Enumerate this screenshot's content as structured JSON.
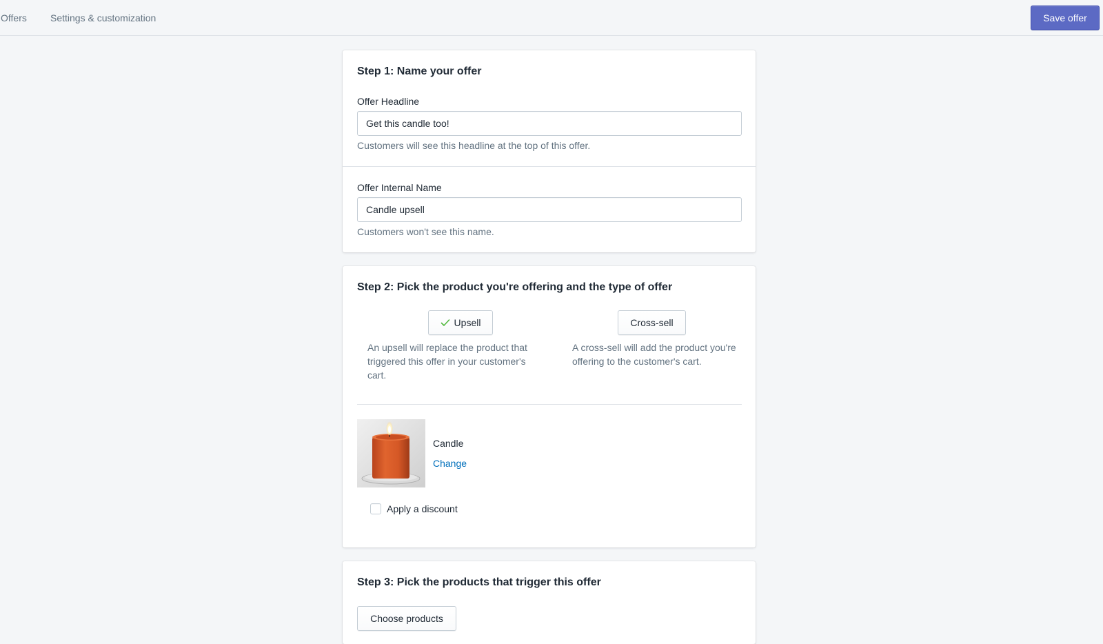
{
  "nav": {
    "offers_label": "Offers",
    "settings_label": "Settings & customization"
  },
  "toolbar": {
    "save_label": "Save offer"
  },
  "step1": {
    "title": "Step 1: Name your offer",
    "headline": {
      "label": "Offer Headline",
      "value": "Get this candle too!",
      "help": "Customers will see this headline at the top of this offer."
    },
    "internal_name": {
      "label": "Offer Internal Name",
      "value": "Candle upsell",
      "help": "Customers won't see this name."
    }
  },
  "step2": {
    "title": "Step 2: Pick the product you're offering and the type of offer",
    "upsell": {
      "label": "Upsell",
      "selected": true,
      "description": "An upsell will replace the product that triggered this offer in your customer's cart."
    },
    "crosssell": {
      "label": "Cross-sell",
      "selected": false,
      "description": "A cross-sell will add the product you're offering to the customer's cart."
    },
    "product": {
      "name": "Candle",
      "change_label": "Change"
    },
    "discount": {
      "label": "Apply a discount",
      "checked": false
    }
  },
  "step3": {
    "title": "Step 3: Pick the products that trigger this offer",
    "choose_label": "Choose products"
  },
  "colors": {
    "primary": "#5c6ac4",
    "link": "#006fbb",
    "check": "#50b83c",
    "background": "#f4f6f8"
  }
}
